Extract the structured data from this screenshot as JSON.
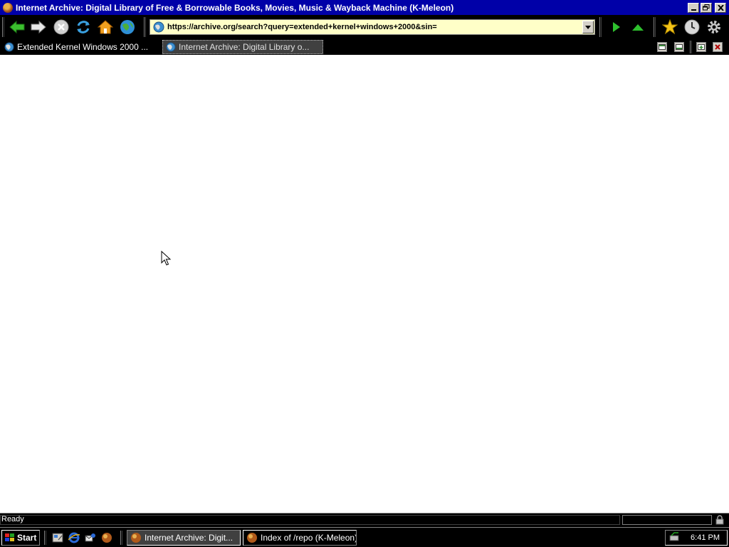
{
  "window": {
    "title": "Internet Archive: Digital Library of Free & Borrowable Books, Movies, Music & Wayback Machine (K-Meleon)"
  },
  "toolbar": {
    "url": "https://archive.org/search?query=extended+kernel+windows+2000&sin="
  },
  "tabs": [
    {
      "label": "Extended Kernel Windows 2000 ...",
      "active": false
    },
    {
      "label": "Internet Archive: Digital Library o...",
      "active": true
    }
  ],
  "status": {
    "text": "Ready"
  },
  "taskbar": {
    "start_label": "Start",
    "tasks": [
      {
        "label": "Internet Archive: Digit...",
        "active": true
      },
      {
        "label": "Index of /repo (K-Meleon)",
        "active": false
      }
    ],
    "clock": "6:41 PM"
  },
  "colors": {
    "titlebar": "#0000a8",
    "url_background": "#ffffc8",
    "content_background": "#ffffff",
    "chrome_background": "#000000"
  }
}
